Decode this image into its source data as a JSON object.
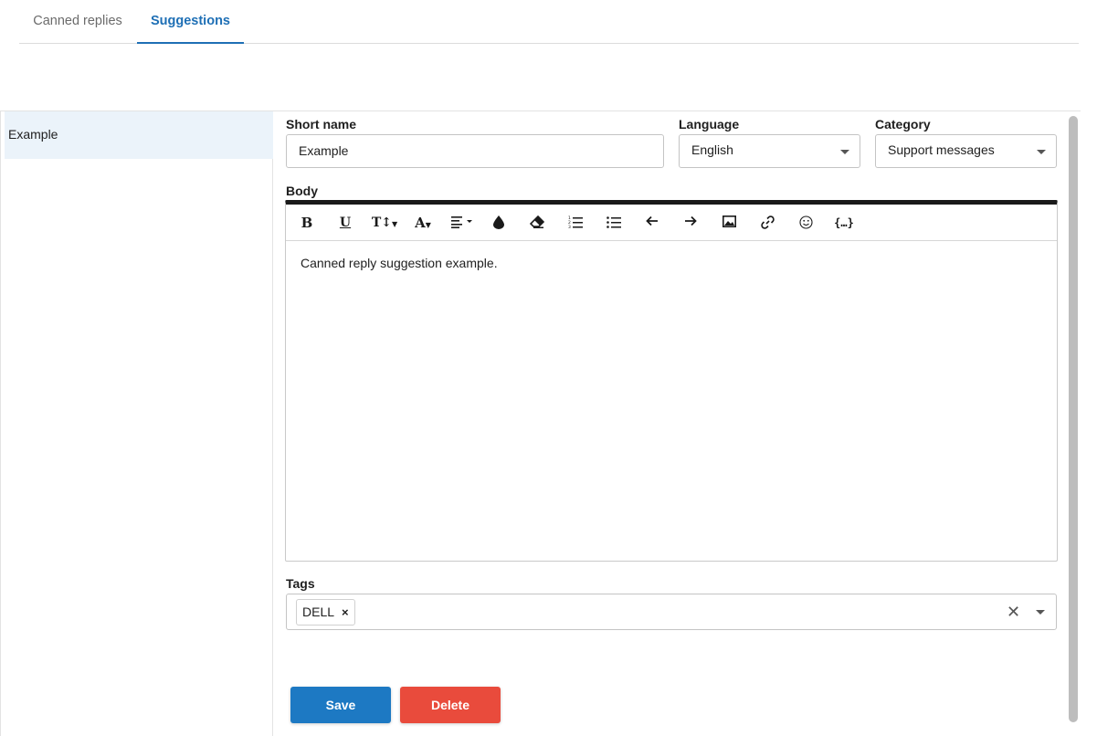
{
  "tabs": [
    {
      "label": "Canned replies"
    },
    {
      "label": "Suggestions",
      "active": true
    }
  ],
  "list": {
    "items": [
      {
        "label": "Example"
      }
    ]
  },
  "form": {
    "short_name": {
      "label": "Short name",
      "value": "Example"
    },
    "language": {
      "label": "Language",
      "value": "English"
    },
    "category": {
      "label": "Category",
      "value": "Support messages"
    },
    "body": {
      "label": "Body",
      "content": "Canned reply suggestion example.",
      "toolbar": [
        "bold-icon",
        "underline-icon",
        "font-size-icon",
        "font-color-icon",
        "align-icon",
        "color-fill-icon",
        "eraser-icon",
        "ordered-list-icon",
        "unordered-list-icon",
        "undo-icon",
        "redo-icon",
        "image-icon",
        "link-icon",
        "emoji-icon",
        "variable-icon"
      ]
    },
    "tags": {
      "label": "Tags",
      "items": [
        "DELL"
      ]
    }
  },
  "buttons": {
    "save": "Save",
    "delete": "Delete"
  },
  "colors": {
    "accent": "#1d79c3",
    "danger": "#e94b3c",
    "selected_bg": "#ebf3fa"
  }
}
